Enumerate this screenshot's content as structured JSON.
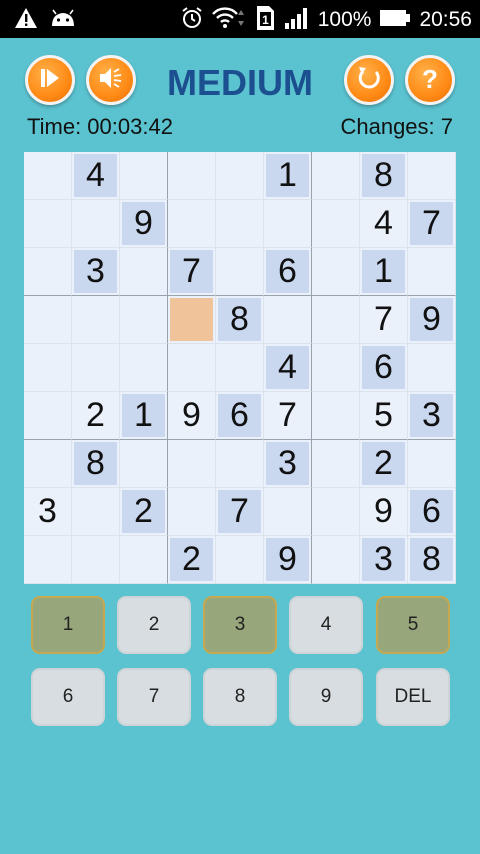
{
  "status_bar": {
    "battery": "100%",
    "time": "20:56",
    "sim": "1"
  },
  "header": {
    "title": "MEDIUM",
    "time_label": "Time: 00:03:42",
    "changes_label": "Changes: 7"
  },
  "board": {
    "rows": [
      [
        "",
        "4",
        "",
        "",
        "",
        "1",
        "",
        "8",
        ""
      ],
      [
        "",
        "",
        "9",
        "",
        "",
        "",
        "",
        "4",
        "7"
      ],
      [
        "",
        "3",
        "",
        "7",
        "",
        "6",
        "",
        "1",
        ""
      ],
      [
        "",
        "",
        "",
        "",
        "8",
        "",
        "",
        "7",
        "9"
      ],
      [
        "",
        "",
        "",
        "",
        "",
        "4",
        "",
        "6",
        ""
      ],
      [
        "",
        "2",
        "1",
        "9",
        "6",
        "7",
        "",
        "5",
        "3"
      ],
      [
        "",
        "8",
        "",
        "",
        "",
        "3",
        "",
        "2",
        ""
      ],
      [
        "3",
        "",
        "2",
        "",
        "7",
        "",
        "",
        "9",
        "6"
      ],
      [
        "",
        "",
        "",
        "2",
        "",
        "9",
        "",
        "3",
        "8"
      ]
    ],
    "highlight": [
      [
        0,
        1,
        0,
        0,
        0,
        1,
        0,
        1,
        0
      ],
      [
        0,
        0,
        1,
        0,
        0,
        0,
        0,
        0,
        1
      ],
      [
        0,
        1,
        0,
        1,
        0,
        1,
        0,
        1,
        0
      ],
      [
        0,
        0,
        0,
        2,
        1,
        0,
        0,
        0,
        1
      ],
      [
        0,
        0,
        0,
        0,
        0,
        1,
        0,
        1,
        0
      ],
      [
        0,
        0,
        1,
        0,
        1,
        0,
        0,
        0,
        1
      ],
      [
        0,
        1,
        0,
        0,
        0,
        1,
        0,
        1,
        0
      ],
      [
        0,
        0,
        1,
        0,
        1,
        0,
        0,
        0,
        1
      ],
      [
        0,
        0,
        0,
        1,
        0,
        1,
        0,
        1,
        1
      ]
    ]
  },
  "keypad": {
    "keys": [
      "1",
      "2",
      "3",
      "4",
      "5",
      "6",
      "7",
      "8",
      "9",
      "DEL"
    ],
    "completed_keys": [
      "1",
      "3",
      "5"
    ]
  },
  "colors": {
    "background": "#5bc2cf",
    "title": "#1c4f8f",
    "given_cell": "#c9d7ef",
    "selected_cell": "#f0c39a",
    "key_completed": "#98a67c",
    "key": "#d7dde0"
  }
}
